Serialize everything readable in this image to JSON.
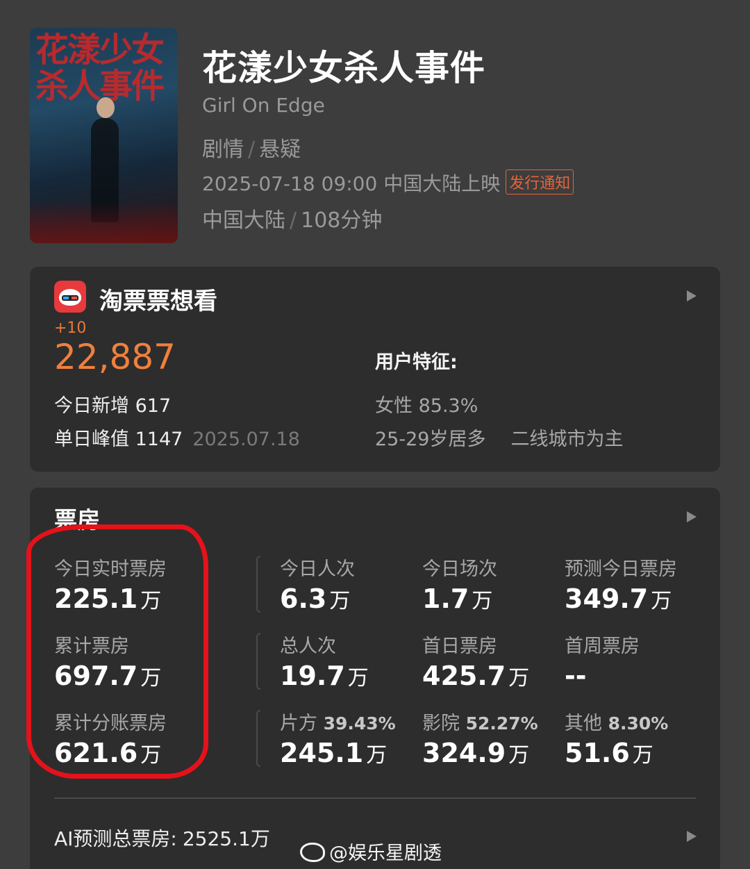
{
  "movie": {
    "title": "花漾少女杀人事件",
    "english_title": "Girl On Edge",
    "genres": [
      "剧情",
      "悬疑"
    ],
    "genre_separator": "/",
    "release": "2025-07-18 09:00 中国大陆上映",
    "release_notice": "发行通知",
    "region": "中国大陆",
    "duration": "108分钟",
    "poster_title": "花漾少女杀人事件"
  },
  "want_to_see": {
    "title": "淘票票想看",
    "delta": "+10",
    "count": "22,887",
    "today_new_label": "今日新增",
    "today_new_value": "617",
    "peak_label": "单日峰值",
    "peak_value": "1147",
    "peak_date": "2025.07.18",
    "features_title": "用户特征:",
    "female": "女性 85.3%",
    "age": "25-29岁居多",
    "city": "二线城市为主"
  },
  "box_office": {
    "title": "票房",
    "unit": "万",
    "stats": [
      {
        "label": "今日实时票房",
        "value": "225.1"
      },
      {
        "label": "今日人次",
        "value": "6.3"
      },
      {
        "label": "今日场次",
        "value": "1.7"
      },
      {
        "label": "预测今日票房",
        "value": "349.7"
      },
      {
        "label": "累计票房",
        "value": "697.7"
      },
      {
        "label": "总人次",
        "value": "19.7"
      },
      {
        "label": "首日票房",
        "value": "425.7"
      },
      {
        "label": "首周票房",
        "value": "--"
      },
      {
        "label": "累计分账票房",
        "value": "621.6"
      },
      {
        "label": "片方",
        "pct": "39.43%",
        "value": "245.1"
      },
      {
        "label": "影院",
        "pct": "52.27%",
        "value": "324.9"
      },
      {
        "label": "其他",
        "pct": "8.30%",
        "value": "51.6"
      }
    ],
    "ai_total_label": "AI预测总票房:",
    "ai_total_value": "2525.1万"
  },
  "watermark": "@娱乐星剧透",
  "colors": {
    "background": "#3d3d3d",
    "card": "#2d2d2d",
    "accent_orange": "#f0803c",
    "highlight_red": "#e4121a"
  }
}
